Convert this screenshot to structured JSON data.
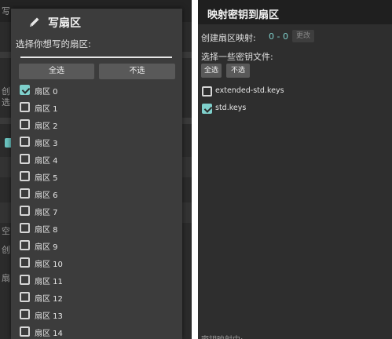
{
  "left": {
    "dialog": {
      "title": "写扇区",
      "prompt": "选择你想写的扇区:",
      "input_value": "",
      "select_all_label": "全选",
      "select_none_label": "不选",
      "sectors": [
        {
          "label": "扇区 0",
          "checked": true
        },
        {
          "label": "扇区 1",
          "checked": false
        },
        {
          "label": "扇区 2",
          "checked": false
        },
        {
          "label": "扇区 3",
          "checked": false
        },
        {
          "label": "扇区 4",
          "checked": false
        },
        {
          "label": "扇区 5",
          "checked": false
        },
        {
          "label": "扇区 6",
          "checked": false
        },
        {
          "label": "扇区 7",
          "checked": false
        },
        {
          "label": "扇区 8",
          "checked": false
        },
        {
          "label": "扇区 9",
          "checked": false
        },
        {
          "label": "扇区 10",
          "checked": false
        },
        {
          "label": "扇区 11",
          "checked": false
        },
        {
          "label": "扇区 12",
          "checked": false
        },
        {
          "label": "扇区 13",
          "checked": false
        },
        {
          "label": "扇区 14",
          "checked": false
        }
      ]
    },
    "background_fragments": {
      "t1": "写",
      "t2": "创",
      "t3": "选",
      "t4": "空",
      "t5": "创",
      "t6": "扇"
    },
    "colors": {
      "accent": "#7fd0cc",
      "dialog_bg": "#3c3c3c",
      "screen_bg": "#2b2b2b"
    }
  },
  "right": {
    "title": "映射密钥到扇区",
    "mapping_label": "创建扇区映射:",
    "mapping_value": "0 - 0",
    "change_button": "更改",
    "keys_prompt": "选择一些密钥文件:",
    "select_all_label": "全选",
    "select_none_label": "不选",
    "key_files": [
      {
        "label": "extended-std.keys",
        "checked": false
      },
      {
        "label": "std.keys",
        "checked": true
      }
    ],
    "footer_text": "密钥映射中:",
    "colors": {
      "accent": "#7fd0cc",
      "header_bg": "#1f1f1f",
      "screen_bg": "#2e2e2e"
    }
  }
}
